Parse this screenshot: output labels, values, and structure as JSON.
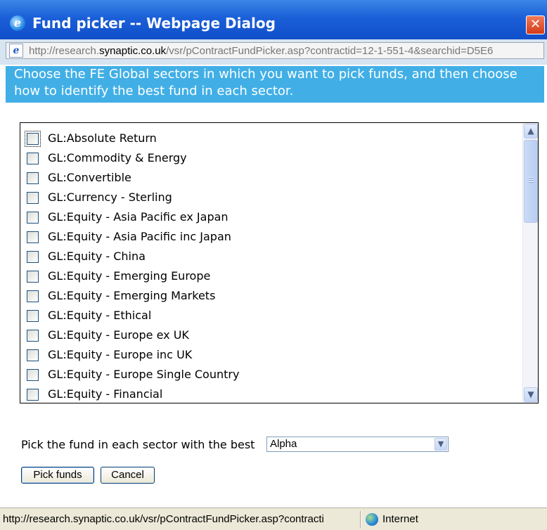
{
  "window": {
    "title": "Fund picker -- Webpage Dialog",
    "close_glyph": "✕",
    "icon": "ie-icon"
  },
  "address": {
    "url_prefix": "http://research.",
    "url_domain": "synaptic.co.uk",
    "url_suffix": "/vsr/pContractFundPicker.asp?contractid=12-1-551-4&searchid=D5E6"
  },
  "banner": {
    "text": "Choose the FE Global sectors in which you want to pick funds, and then choose how to identify the best fund in each sector."
  },
  "sectors": [
    {
      "label": "GL:Absolute Return",
      "checked": false
    },
    {
      "label": "GL:Commodity & Energy",
      "checked": false
    },
    {
      "label": "GL:Convertible",
      "checked": false
    },
    {
      "label": "GL:Currency - Sterling",
      "checked": false
    },
    {
      "label": "GL:Equity - Asia Pacific ex Japan",
      "checked": false
    },
    {
      "label": "GL:Equity - Asia Pacific inc Japan",
      "checked": false
    },
    {
      "label": "GL:Equity - China",
      "checked": false
    },
    {
      "label": "GL:Equity - Emerging Europe",
      "checked": false
    },
    {
      "label": "GL:Equity - Emerging Markets",
      "checked": false
    },
    {
      "label": "GL:Equity - Ethical",
      "checked": false
    },
    {
      "label": "GL:Equity - Europe ex UK",
      "checked": false
    },
    {
      "label": "GL:Equity - Europe inc UK",
      "checked": false
    },
    {
      "label": "GL:Equity - Europe Single Country",
      "checked": false
    },
    {
      "label": "GL:Equity - Financial",
      "checked": false
    }
  ],
  "scroll": {
    "up_glyph": "▲",
    "down_glyph": "▼"
  },
  "pick": {
    "label": "Pick the fund in each sector with the best",
    "selected": "Alpha",
    "arrow_glyph": "▼"
  },
  "buttons": {
    "pick_funds": "Pick funds",
    "cancel": "Cancel"
  },
  "status": {
    "url": "http://research.synaptic.co.uk/vsr/pContractFundPicker.asp?contracti",
    "zone": "Internet"
  },
  "colors": {
    "titlebar": "#1b5fd8",
    "banner": "#41afe6",
    "close": "#d33b17"
  }
}
